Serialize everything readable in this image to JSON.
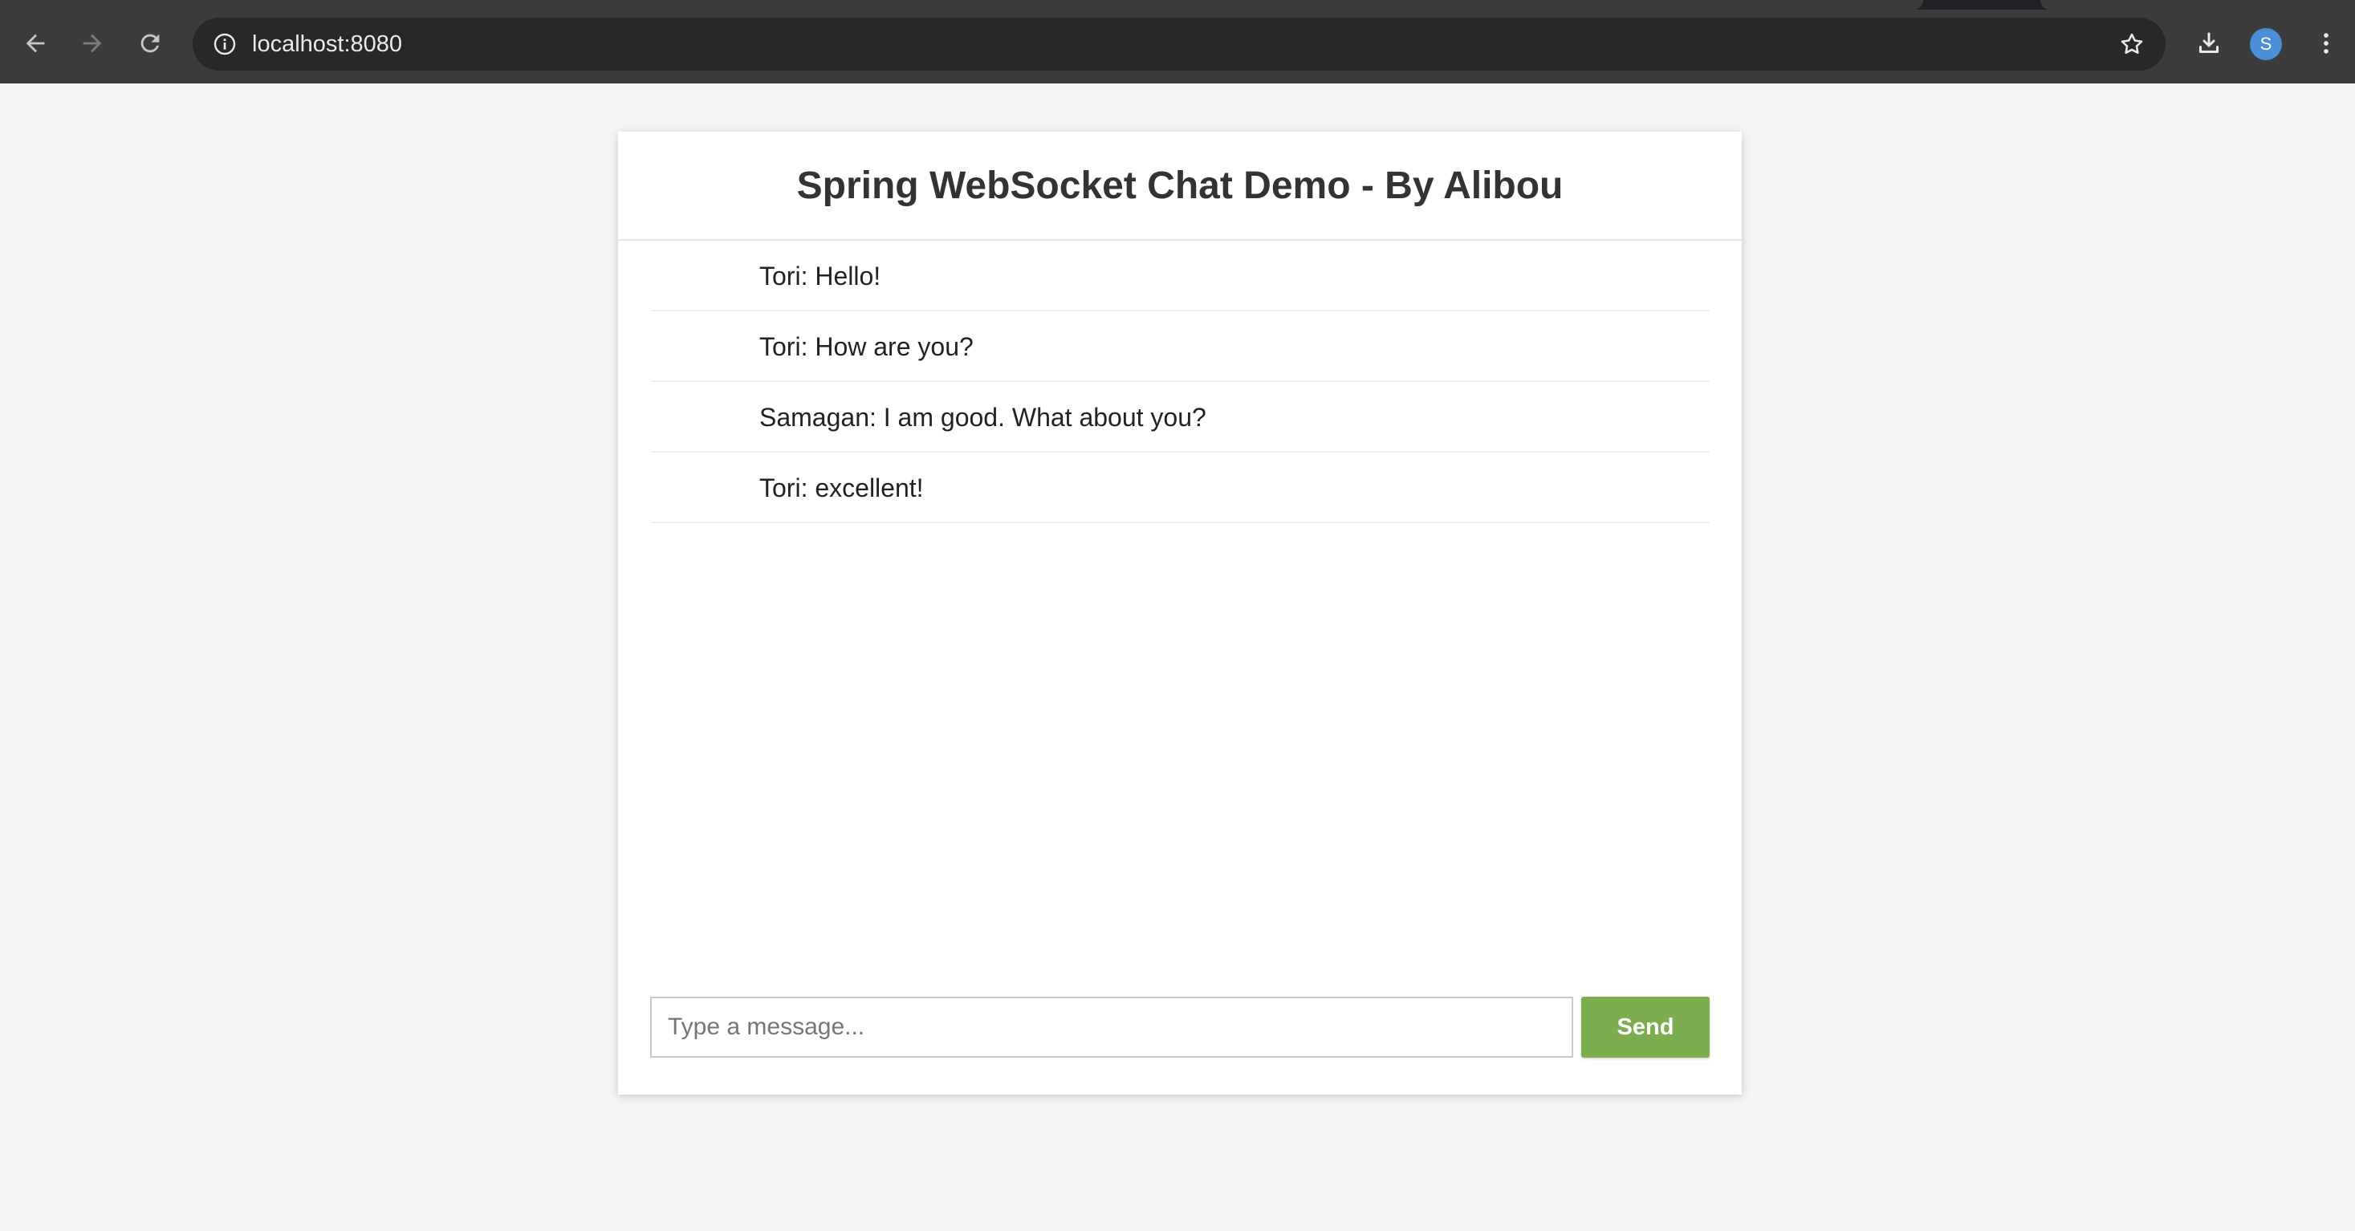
{
  "browser": {
    "url": "localhost:8080",
    "profile_initial": "S",
    "icons": {
      "back": "back-arrow-icon",
      "forward": "forward-arrow-icon",
      "reload": "reload-icon",
      "site_info": "info-icon",
      "bookmark": "star-icon",
      "downloads": "download-icon",
      "menu": "kebab-menu-icon"
    }
  },
  "chat": {
    "title": "Spring WebSocket Chat Demo - By Alibou",
    "messages": [
      "Tori: Hello!",
      "Tori: How are you?",
      "Samagan: I am good. What about you?",
      "Tori: excellent!"
    ],
    "input_placeholder": "Type a message...",
    "input_value": "",
    "send_label": "Send"
  },
  "colors": {
    "page_background": "#f4f4f4",
    "send_button": "#7cad4f",
    "avatar": "#4a8fd8"
  }
}
